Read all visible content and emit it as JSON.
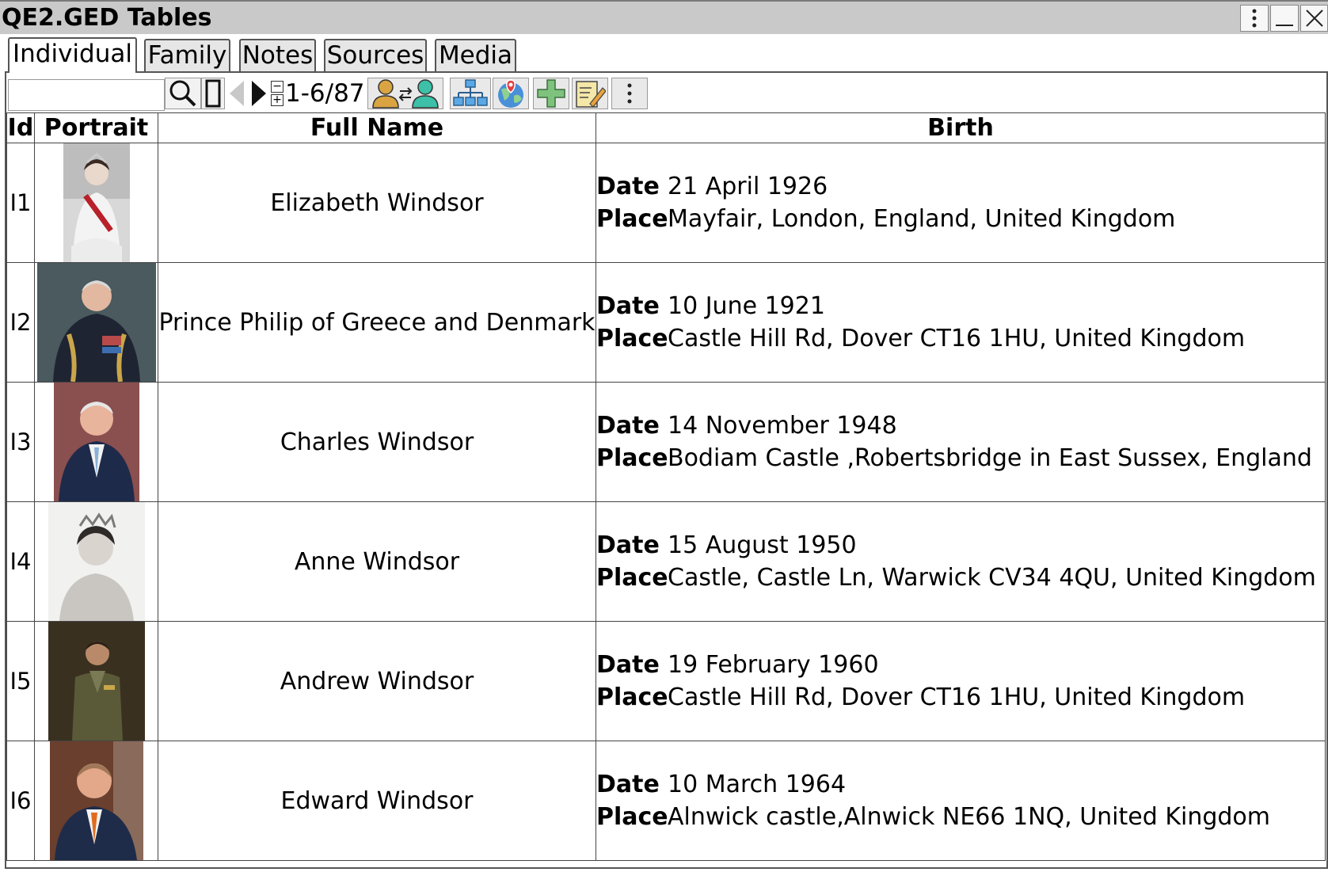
{
  "window": {
    "title": "QE2.GED Tables"
  },
  "tabs": [
    {
      "label": "Individual",
      "active": true
    },
    {
      "label": "Family",
      "active": false
    },
    {
      "label": "Notes",
      "active": false
    },
    {
      "label": "Sources",
      "active": false
    },
    {
      "label": "Media",
      "active": false
    }
  ],
  "toolbar": {
    "search_value": "",
    "pager": "1-6/87",
    "icons": [
      "search-icon",
      "view-toggle-icon",
      "prev-page-icon",
      "next-page-icon",
      "zoom-stepper-icon",
      "swap-persons-icon",
      "tree-icon",
      "map-icon",
      "add-icon",
      "edit-icon",
      "more-icon"
    ]
  },
  "table": {
    "headers": {
      "id": "Id",
      "portrait": "Portrait",
      "name": "Full Name",
      "birth": "Birth"
    },
    "date_label": "Date",
    "place_label": "Place",
    "rows": [
      {
        "id": "I1",
        "name": "Elizabeth Windsor",
        "date": "21 April 1926",
        "place": "Mayfair, London, England, United Kingdom"
      },
      {
        "id": "I2",
        "name": "Prince Philip of Greece and Denmark",
        "date": "10 June 1921",
        "place": "Castle Hill Rd, Dover CT16 1HU, United Kingdom"
      },
      {
        "id": "I3",
        "name": "Charles Windsor",
        "date": "14 November 1948",
        "place": "Bodiam Castle ,Robertsbridge in East Sussex, England"
      },
      {
        "id": "I4",
        "name": "Anne Windsor",
        "date": "15 August 1950",
        "place": "Castle, Castle Ln, Warwick CV34 4QU, United Kingdom"
      },
      {
        "id": "I5",
        "name": "Andrew Windsor",
        "date": "19 February 1960",
        "place": "Castle Hill Rd, Dover CT16 1HU, United Kingdom"
      },
      {
        "id": "I6",
        "name": "Edward Windsor",
        "date": "10 March 1964",
        "place": "Alnwick castle,Alnwick NE66 1NQ, United Kingdom"
      }
    ]
  }
}
